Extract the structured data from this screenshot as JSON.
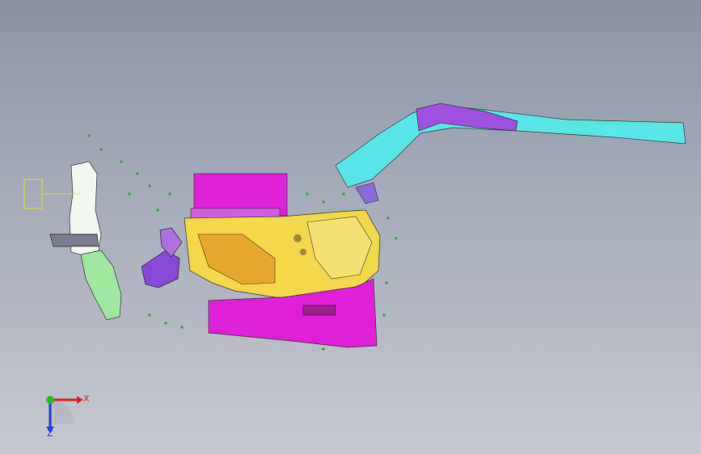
{
  "colors": {
    "background_top": "#8a93a6",
    "background_bottom": "#c5c8d0",
    "magenta_parts": "#e020d8",
    "yellow_parts": "#f2d84a",
    "cyan_parts": "#59e6e6",
    "purple_parts": "#8a48d8",
    "green_parts": "#9ee8a0",
    "x_axis": "#e02020",
    "y_axis": "#20c020",
    "z_axis": "#2040e0"
  },
  "triad": {
    "x_label": "X",
    "z_label": "Z"
  }
}
